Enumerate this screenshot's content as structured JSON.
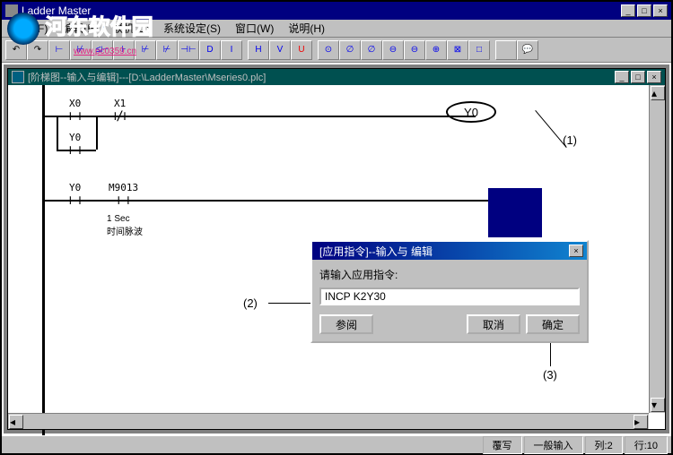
{
  "app": {
    "title": "Ladder Master",
    "watermark": "河东软件园",
    "watermark_url": "www.pc0359.cn"
  },
  "menu": {
    "items": [
      "文件(F)",
      "编辑(E)",
      "联机(C)",
      "系统设定(S)",
      "窗口(W)",
      "说明(H)"
    ]
  },
  "toolbar": {
    "icons": [
      "↶",
      "↷",
      "⊢",
      "⊬",
      "≤⊢",
      "⊦",
      "B",
      "⊬",
      "⊬",
      "B",
      "⊣⊢",
      "D",
      "I",
      "",
      "|",
      "H",
      "|",
      "V",
      "U",
      "",
      "⊙",
      "O",
      "∅",
      "T",
      "∅",
      "C",
      "⊖",
      "S",
      "⊖",
      "R",
      "⊕",
      "U",
      "⊠",
      "D",
      "□",
      "F",
      "",
      "💬",
      "⟳"
    ]
  },
  "child": {
    "title": "[阶梯图--输入与编辑]---[D:\\LadderMaster\\Mseries0.plc]"
  },
  "ladder": {
    "row1": {
      "c1": "X0",
      "c2": "X1",
      "coil": "Y0"
    },
    "row1b": {
      "c1": "Y0"
    },
    "row2": {
      "c1": "Y0",
      "c2": "M9013",
      "note1": "1 Sec",
      "note2": "时间脉波"
    }
  },
  "dialog": {
    "title": "[应用指令]--输入与 编辑",
    "label": "请输入应用指令:",
    "value": "INCP K2Y30",
    "ref_btn": "参阅",
    "cancel_btn": "取消",
    "ok_btn": "确定"
  },
  "annotations": {
    "a1": "(1)",
    "a2": "(2)",
    "a3": "(3)"
  },
  "status": {
    "s1": "覆写",
    "s2": "一般输入",
    "s3": "列:2",
    "s4": "行:10"
  }
}
